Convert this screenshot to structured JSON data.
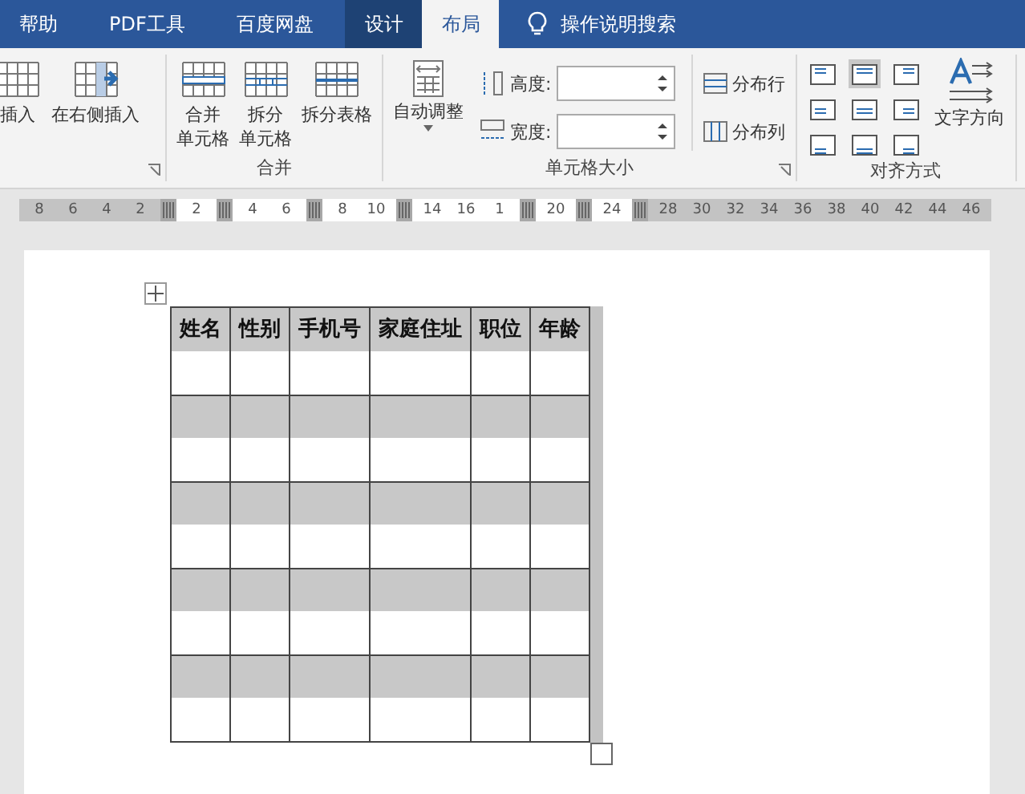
{
  "tabs": [
    {
      "label": "帮助",
      "selected": false,
      "kind": "tab"
    },
    {
      "label": "PDF工具",
      "selected": false,
      "kind": "tab"
    },
    {
      "label": "百度网盘",
      "selected": false,
      "kind": "tab"
    },
    {
      "label": "设计",
      "selected": false,
      "kind": "context"
    },
    {
      "label": "布局",
      "selected": true,
      "kind": "tab"
    }
  ],
  "tell_me": {
    "label": "操作说明搜索"
  },
  "groups": [
    {
      "launcher": true,
      "buttons": [
        {
          "lines": [
            "插入"
          ]
        },
        {
          "lines": [
            "在右侧插入"
          ]
        }
      ]
    },
    {
      "label": "合并",
      "launcher": false,
      "buttons": [
        {
          "lines": [
            "合并",
            "单元格"
          ]
        },
        {
          "lines": [
            "拆分",
            "单元格"
          ]
        },
        {
          "lines": [
            "拆分表格"
          ]
        }
      ]
    },
    {
      "label": "单元格大小",
      "launcher": true,
      "kind": "size",
      "autofit": {
        "label": "自动调整"
      },
      "fields": [
        {
          "label": "高度:"
        },
        {
          "label": "宽度:"
        }
      ],
      "distribute": [
        {
          "label": "分布行"
        },
        {
          "label": "分布列"
        }
      ]
    },
    {
      "label": "对齐方式",
      "launcher": false,
      "kind": "align",
      "cells": [
        {
          "selected": false
        },
        {
          "selected": true
        },
        {
          "selected": false
        },
        {
          "selected": false
        },
        {
          "selected": false
        },
        {
          "selected": false
        },
        {
          "selected": false
        },
        {
          "selected": false
        },
        {
          "selected": false
        }
      ],
      "direction": {
        "label": "文字方向"
      }
    }
  ],
  "ruler": [
    {
      "kind": "margin",
      "labels": [
        "8",
        "6",
        "4",
        "2"
      ]
    },
    {
      "kind": "column",
      "labels": [
        "2"
      ]
    },
    {
      "kind": "column",
      "labels": [
        "4",
        "6"
      ]
    },
    {
      "kind": "column",
      "labels": [
        "8",
        "10"
      ]
    },
    {
      "kind": "column",
      "labels": [
        "14",
        "16",
        "1"
      ]
    },
    {
      "kind": "column",
      "labels": [
        "20"
      ]
    },
    {
      "kind": "column",
      "labels": [
        "24"
      ]
    },
    {
      "kind": "margin",
      "labels": [
        "28",
        "30",
        "32",
        "34",
        "36",
        "38",
        "40",
        "42",
        "44",
        "46"
      ]
    }
  ],
  "table": {
    "columns": [
      "姓名",
      "性别",
      "手机号",
      "家庭住址",
      "职位",
      "年龄"
    ]
  }
}
